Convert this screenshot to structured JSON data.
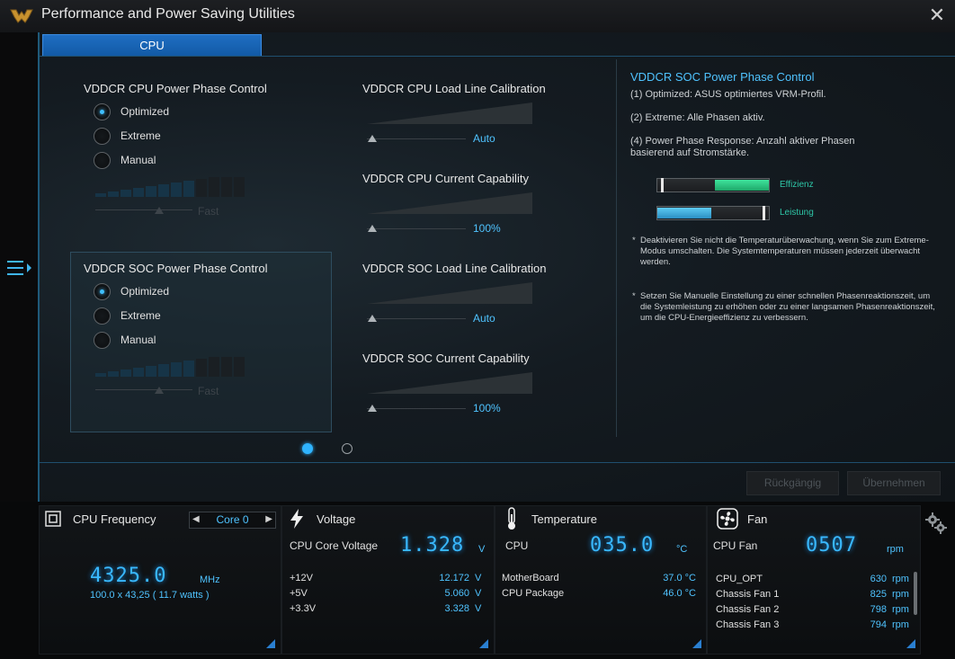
{
  "window": {
    "title": "Performance and Power Saving Utilities",
    "close_glyph": "✕"
  },
  "tabs": [
    {
      "label": "CPU"
    }
  ],
  "cpu_phase": {
    "title": "VDDCR CPU Power Phase Control",
    "options": [
      "Optimized",
      "Extreme",
      "Manual"
    ],
    "selected": "Optimized",
    "speed_label": "Fast"
  },
  "soc_phase": {
    "title": "VDDCR SOC Power Phase Control",
    "options": [
      "Optimized",
      "Extreme",
      "Manual"
    ],
    "selected": "Optimized",
    "speed_label": "Fast"
  },
  "sliders": [
    {
      "title": "VDDCR CPU Load Line Calibration",
      "value": "Auto"
    },
    {
      "title": "VDDCR CPU Current Capability",
      "value": "100%"
    },
    {
      "title": "VDDCR SOC Load Line Calibration",
      "value": "Auto"
    },
    {
      "title": "VDDCR SOC Current Capability",
      "value": "100%"
    }
  ],
  "help": {
    "title": "VDDCR SOC Power Phase Control",
    "line1": "(1) Optimized: ASUS optimiertes VRM-Profil.",
    "line2": "(2) Extreme: Alle Phasen aktiv.",
    "line3": "(4) Power Phase Response: Anzahl aktiver Phasen basierend auf Stromstärke.",
    "bar1_label": "Effizienz",
    "bar2_label": "Leistung",
    "note1": "Deaktivieren Sie nicht die Temperaturüberwachung, wenn Sie zum Extreme-Modus umschalten. Die Systemtemperaturen müssen jederzeit überwacht werden.",
    "note2": "Setzen Sie Manuelle Einstellung zu einer schnellen Phasenreaktionszeit, um die Systemleistung zu erhöhen oder zu einer langsamen Phasenreaktionszeit, um die CPU-Energieeffizienz zu verbessern.",
    "bullet": "*"
  },
  "buttons": {
    "undo": "Rückgängig",
    "apply": "Übernehmen"
  },
  "monitor": {
    "cpu": {
      "title": "CPU Frequency",
      "core": "Core 0",
      "freq": "4325.0",
      "freq_unit": "MHz",
      "detail": "100.0  x  43,25 ( 11.7  watts )"
    },
    "voltage": {
      "title": "Voltage",
      "main_label": "CPU Core Voltage",
      "main_value": "1.328",
      "main_unit": "V",
      "rows": [
        {
          "label": "+12V",
          "value": "12.172",
          "unit": "V"
        },
        {
          "label": "+5V",
          "value": "5.060",
          "unit": "V"
        },
        {
          "label": "+3.3V",
          "value": "3.328",
          "unit": "V"
        }
      ]
    },
    "temperature": {
      "title": "Temperature",
      "main_label": "CPU",
      "main_value": "035.0",
      "main_unit": "°C",
      "rows": [
        {
          "label": "MotherBoard",
          "value": "37.0 °C"
        },
        {
          "label": "CPU Package",
          "value": "46.0 °C"
        }
      ]
    },
    "fan": {
      "title": "Fan",
      "main_label": "CPU Fan",
      "main_value": "0507",
      "main_unit": "rpm",
      "rows": [
        {
          "label": "CPU_OPT",
          "value": "630",
          "unit": "rpm"
        },
        {
          "label": "Chassis Fan 1",
          "value": "825",
          "unit": "rpm"
        },
        {
          "label": "Chassis Fan 2",
          "value": "798",
          "unit": "rpm"
        },
        {
          "label": "Chassis Fan 3",
          "value": "794",
          "unit": "rpm"
        }
      ]
    }
  },
  "icons": [
    "logo-icon",
    "close-icon",
    "menu-icon",
    "chip-icon",
    "lightning-icon",
    "thermometer-icon",
    "fan-icon",
    "gear-icon"
  ],
  "colors": {
    "accent": "#4fc3ff",
    "tab": "#1a66b8",
    "help_bar_green": "#2bd38a",
    "help_bar_blue": "#3aa8d8"
  },
  "indicators": {
    "efficiency_fraction": 0.5,
    "performance_fraction": 0.5
  }
}
